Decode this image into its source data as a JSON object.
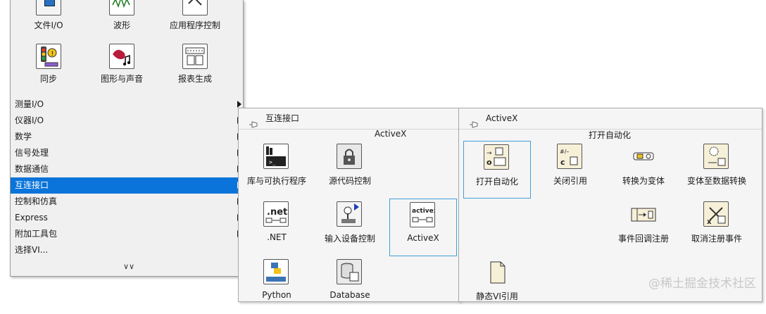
{
  "main_panel": {
    "tiles": [
      {
        "label": "文件I/O",
        "icon": "file-io-icon"
      },
      {
        "label": "波形",
        "icon": "waveform-icon"
      },
      {
        "label": "应用程序控制",
        "icon": "app-control-icon"
      },
      {
        "label": "同步",
        "icon": "sync-icon"
      },
      {
        "label": "图形与声音",
        "icon": "graphics-sound-icon"
      },
      {
        "label": "报表生成",
        "icon": "report-icon"
      }
    ],
    "menu": [
      {
        "label": "测量I/O"
      },
      {
        "label": "仪器I/O"
      },
      {
        "label": "数学"
      },
      {
        "label": "信号处理"
      },
      {
        "label": "数据通信"
      },
      {
        "label": "互连接口"
      },
      {
        "label": "控制和仿真"
      },
      {
        "label": "Express"
      },
      {
        "label": "附加工具包"
      },
      {
        "label": "选择VI..."
      }
    ],
    "more_glyph": "∨∨"
  },
  "interconnect_panel": {
    "title": "互连接口",
    "section": "ActiveX",
    "tiles": [
      {
        "label": "库与可执行程序"
      },
      {
        "label": "源代码控制"
      },
      {
        "label": ".NET"
      },
      {
        "label": "输入设备控制"
      },
      {
        "label": "ActiveX"
      },
      {
        "label": "Python"
      },
      {
        "label": "Database"
      }
    ]
  },
  "activex_panel": {
    "title": "ActiveX",
    "section": "打开自动化",
    "tiles": [
      {
        "label": "打开自动化"
      },
      {
        "label": "关闭引用"
      },
      {
        "label": "转换为变体"
      },
      {
        "label": "变体至数据转换"
      },
      {
        "label": "事件回调注册"
      },
      {
        "label": "取消注册事件"
      },
      {
        "label": "静态VI引用"
      }
    ]
  },
  "watermark": "@稀土掘金技术社区",
  "colors": {
    "highlight": "#0a74da",
    "selection_border": "#3fa0d9",
    "panel_bg": "#f0f0f0"
  }
}
